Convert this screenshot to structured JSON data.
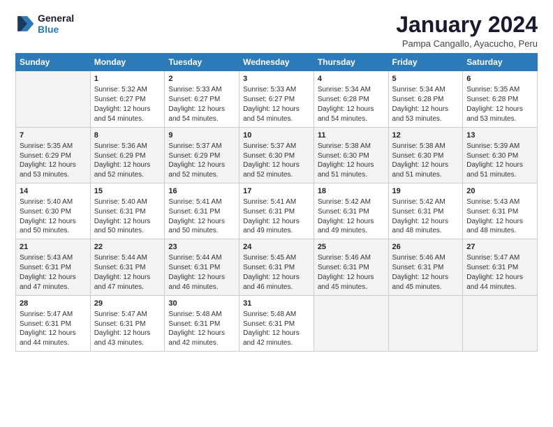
{
  "logo": {
    "line1": "General",
    "line2": "Blue"
  },
  "title": "January 2024",
  "location": "Pampa Cangallo, Ayacucho, Peru",
  "days_of_week": [
    "Sunday",
    "Monday",
    "Tuesday",
    "Wednesday",
    "Thursday",
    "Friday",
    "Saturday"
  ],
  "weeks": [
    [
      {
        "day": "",
        "info": ""
      },
      {
        "day": "1",
        "info": "Sunrise: 5:32 AM\nSunset: 6:27 PM\nDaylight: 12 hours\nand 54 minutes."
      },
      {
        "day": "2",
        "info": "Sunrise: 5:33 AM\nSunset: 6:27 PM\nDaylight: 12 hours\nand 54 minutes."
      },
      {
        "day": "3",
        "info": "Sunrise: 5:33 AM\nSunset: 6:27 PM\nDaylight: 12 hours\nand 54 minutes."
      },
      {
        "day": "4",
        "info": "Sunrise: 5:34 AM\nSunset: 6:28 PM\nDaylight: 12 hours\nand 54 minutes."
      },
      {
        "day": "5",
        "info": "Sunrise: 5:34 AM\nSunset: 6:28 PM\nDaylight: 12 hours\nand 53 minutes."
      },
      {
        "day": "6",
        "info": "Sunrise: 5:35 AM\nSunset: 6:28 PM\nDaylight: 12 hours\nand 53 minutes."
      }
    ],
    [
      {
        "day": "7",
        "info": "Sunrise: 5:35 AM\nSunset: 6:29 PM\nDaylight: 12 hours\nand 53 minutes."
      },
      {
        "day": "8",
        "info": "Sunrise: 5:36 AM\nSunset: 6:29 PM\nDaylight: 12 hours\nand 52 minutes."
      },
      {
        "day": "9",
        "info": "Sunrise: 5:37 AM\nSunset: 6:29 PM\nDaylight: 12 hours\nand 52 minutes."
      },
      {
        "day": "10",
        "info": "Sunrise: 5:37 AM\nSunset: 6:30 PM\nDaylight: 12 hours\nand 52 minutes."
      },
      {
        "day": "11",
        "info": "Sunrise: 5:38 AM\nSunset: 6:30 PM\nDaylight: 12 hours\nand 51 minutes."
      },
      {
        "day": "12",
        "info": "Sunrise: 5:38 AM\nSunset: 6:30 PM\nDaylight: 12 hours\nand 51 minutes."
      },
      {
        "day": "13",
        "info": "Sunrise: 5:39 AM\nSunset: 6:30 PM\nDaylight: 12 hours\nand 51 minutes."
      }
    ],
    [
      {
        "day": "14",
        "info": "Sunrise: 5:40 AM\nSunset: 6:30 PM\nDaylight: 12 hours\nand 50 minutes."
      },
      {
        "day": "15",
        "info": "Sunrise: 5:40 AM\nSunset: 6:31 PM\nDaylight: 12 hours\nand 50 minutes."
      },
      {
        "day": "16",
        "info": "Sunrise: 5:41 AM\nSunset: 6:31 PM\nDaylight: 12 hours\nand 50 minutes."
      },
      {
        "day": "17",
        "info": "Sunrise: 5:41 AM\nSunset: 6:31 PM\nDaylight: 12 hours\nand 49 minutes."
      },
      {
        "day": "18",
        "info": "Sunrise: 5:42 AM\nSunset: 6:31 PM\nDaylight: 12 hours\nand 49 minutes."
      },
      {
        "day": "19",
        "info": "Sunrise: 5:42 AM\nSunset: 6:31 PM\nDaylight: 12 hours\nand 48 minutes."
      },
      {
        "day": "20",
        "info": "Sunrise: 5:43 AM\nSunset: 6:31 PM\nDaylight: 12 hours\nand 48 minutes."
      }
    ],
    [
      {
        "day": "21",
        "info": "Sunrise: 5:43 AM\nSunset: 6:31 PM\nDaylight: 12 hours\nand 47 minutes."
      },
      {
        "day": "22",
        "info": "Sunrise: 5:44 AM\nSunset: 6:31 PM\nDaylight: 12 hours\nand 47 minutes."
      },
      {
        "day": "23",
        "info": "Sunrise: 5:44 AM\nSunset: 6:31 PM\nDaylight: 12 hours\nand 46 minutes."
      },
      {
        "day": "24",
        "info": "Sunrise: 5:45 AM\nSunset: 6:31 PM\nDaylight: 12 hours\nand 46 minutes."
      },
      {
        "day": "25",
        "info": "Sunrise: 5:46 AM\nSunset: 6:31 PM\nDaylight: 12 hours\nand 45 minutes."
      },
      {
        "day": "26",
        "info": "Sunrise: 5:46 AM\nSunset: 6:31 PM\nDaylight: 12 hours\nand 45 minutes."
      },
      {
        "day": "27",
        "info": "Sunrise: 5:47 AM\nSunset: 6:31 PM\nDaylight: 12 hours\nand 44 minutes."
      }
    ],
    [
      {
        "day": "28",
        "info": "Sunrise: 5:47 AM\nSunset: 6:31 PM\nDaylight: 12 hours\nand 44 minutes."
      },
      {
        "day": "29",
        "info": "Sunrise: 5:47 AM\nSunset: 6:31 PM\nDaylight: 12 hours\nand 43 minutes."
      },
      {
        "day": "30",
        "info": "Sunrise: 5:48 AM\nSunset: 6:31 PM\nDaylight: 12 hours\nand 42 minutes."
      },
      {
        "day": "31",
        "info": "Sunrise: 5:48 AM\nSunset: 6:31 PM\nDaylight: 12 hours\nand 42 minutes."
      },
      {
        "day": "",
        "info": ""
      },
      {
        "day": "",
        "info": ""
      },
      {
        "day": "",
        "info": ""
      }
    ]
  ]
}
